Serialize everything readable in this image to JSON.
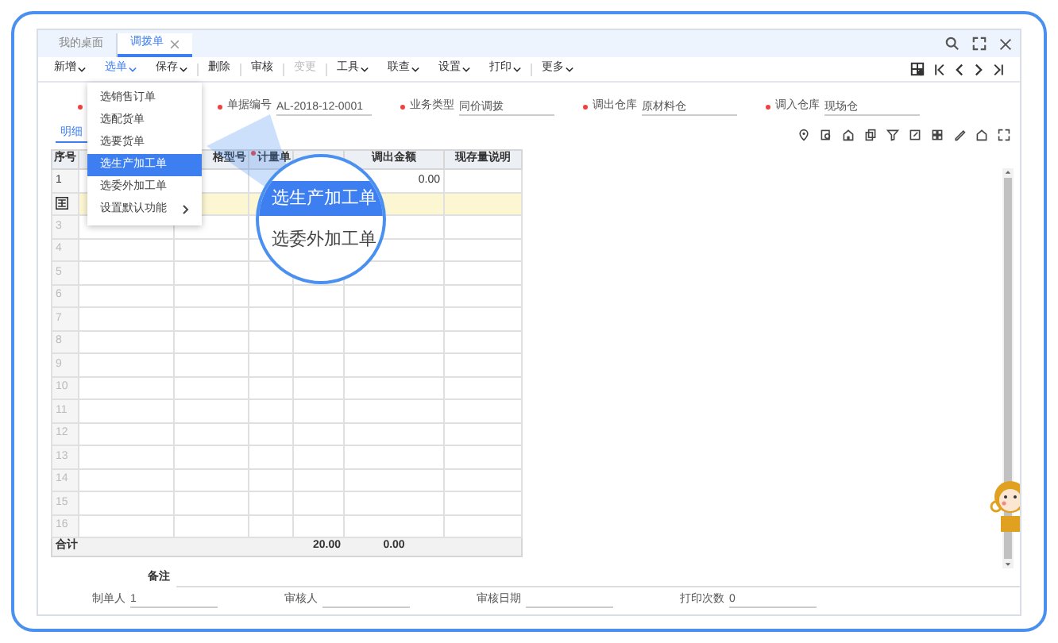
{
  "tabs": [
    {
      "label": "我的桌面",
      "selected": false,
      "closable": false
    },
    {
      "label": "调拨单",
      "selected": true,
      "closable": true
    }
  ],
  "toolbar": [
    {
      "label": "新增",
      "dropdown": true,
      "disabled": false
    },
    {
      "label": "选单",
      "dropdown": true,
      "disabled": false,
      "selected": true
    },
    {
      "label": "保存",
      "dropdown": true,
      "disabled": false
    },
    {
      "label": "删除",
      "dropdown": false,
      "disabled": false
    },
    {
      "label": "审核",
      "dropdown": false,
      "disabled": false
    },
    {
      "label": "变更",
      "dropdown": false,
      "disabled": true
    },
    {
      "label": "工具",
      "dropdown": true,
      "disabled": false
    },
    {
      "label": "联查",
      "dropdown": true,
      "disabled": false
    },
    {
      "label": "设置",
      "dropdown": true,
      "disabled": false
    },
    {
      "label": "打印",
      "dropdown": true,
      "disabled": false
    },
    {
      "label": "更多",
      "dropdown": true,
      "disabled": false
    }
  ],
  "dropdown_menu": [
    {
      "label": "选销售订单",
      "selected": false,
      "submenu": false
    },
    {
      "label": "选配货单",
      "selected": false,
      "submenu": false
    },
    {
      "label": "选要货单",
      "selected": false,
      "submenu": false
    },
    {
      "label": "选生产加工单",
      "selected": true,
      "submenu": false
    },
    {
      "label": "选委外加工单",
      "selected": false,
      "submenu": false
    },
    {
      "label": "设置默认功能",
      "selected": false,
      "submenu": true
    }
  ],
  "magnifier": [
    {
      "label": "选生产加工单",
      "selected": true
    },
    {
      "label": "选委外加工单",
      "selected": false
    }
  ],
  "form_fields": [
    {
      "required": true
    },
    {
      "label": "单据编号",
      "value": "AL-2018-12-0001",
      "required": true
    },
    {
      "label": "业务类型",
      "value": "同价调拨",
      "required": true
    },
    {
      "label": "调出仓库",
      "value": "原材料仓",
      "required": true
    },
    {
      "label": "调入仓库",
      "value": "现场仓",
      "required": true
    }
  ],
  "detail_tabs": [
    {
      "label": "明细",
      "selected": true
    }
  ],
  "table": {
    "columns": [
      {
        "label": "序号"
      },
      {},
      {
        "label": "格型号"
      },
      {
        "label": "计量单",
        "required": true
      },
      {},
      {
        "label": "调出金额"
      },
      {
        "label": "现存量说明"
      }
    ],
    "rows": [
      {
        "number": "1",
        "amount": "0.00",
        "selected": false
      },
      {
        "selected": true
      },
      {
        "number": "3",
        "selected": false
      },
      {
        "number": "4",
        "selected": false
      },
      {
        "number": "5",
        "selected": false
      },
      {
        "number": "6",
        "selected": false
      },
      {
        "number": "7",
        "selected": false
      },
      {
        "number": "8",
        "selected": false
      },
      {
        "number": "9",
        "selected": false
      },
      {
        "number": "10",
        "selected": false
      },
      {
        "number": "11",
        "selected": false
      },
      {
        "number": "12",
        "selected": false
      },
      {
        "number": "13",
        "selected": false
      },
      {
        "number": "14",
        "selected": false
      },
      {
        "number": "15",
        "selected": false
      },
      {
        "number": "16",
        "selected": false
      }
    ],
    "total": {
      "label": "合计",
      "quantity": "20.00",
      "amount": "0.00"
    }
  },
  "remark": {
    "label": "备注"
  },
  "footer_fields": [
    {
      "label": "制单人",
      "value": "1"
    },
    {
      "label": "审核人"
    },
    {
      "label": "审核日期"
    },
    {
      "label": "打印次数",
      "value": "0"
    }
  ]
}
